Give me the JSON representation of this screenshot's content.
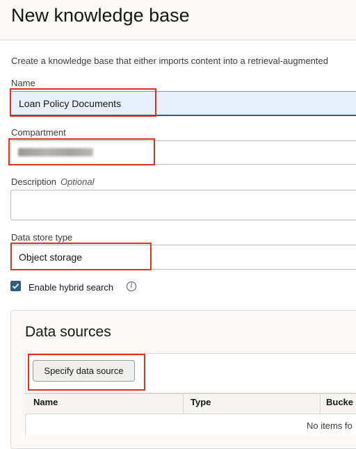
{
  "header": {
    "title": "New knowledge base"
  },
  "intro": "Create a knowledge base that either imports content into a retrieval-augmented",
  "form": {
    "name": {
      "label": "Name",
      "value": "Loan Policy Documents"
    },
    "compartment": {
      "label": "Compartment",
      "value_redacted": true
    },
    "description": {
      "label": "Description",
      "optional_label": "Optional",
      "value": ""
    },
    "data_store_type": {
      "label": "Data store type",
      "value": "Object storage"
    },
    "hybrid_search": {
      "label": "Enable hybrid search",
      "checked": true
    }
  },
  "data_sources": {
    "title": "Data sources",
    "specify_button": "Specify data source",
    "columns": [
      "Name",
      "Type",
      "Bucke"
    ],
    "empty_text": "No items fo"
  },
  "colors": {
    "accent": "#2a5d7f",
    "highlight": "#e0311f"
  }
}
